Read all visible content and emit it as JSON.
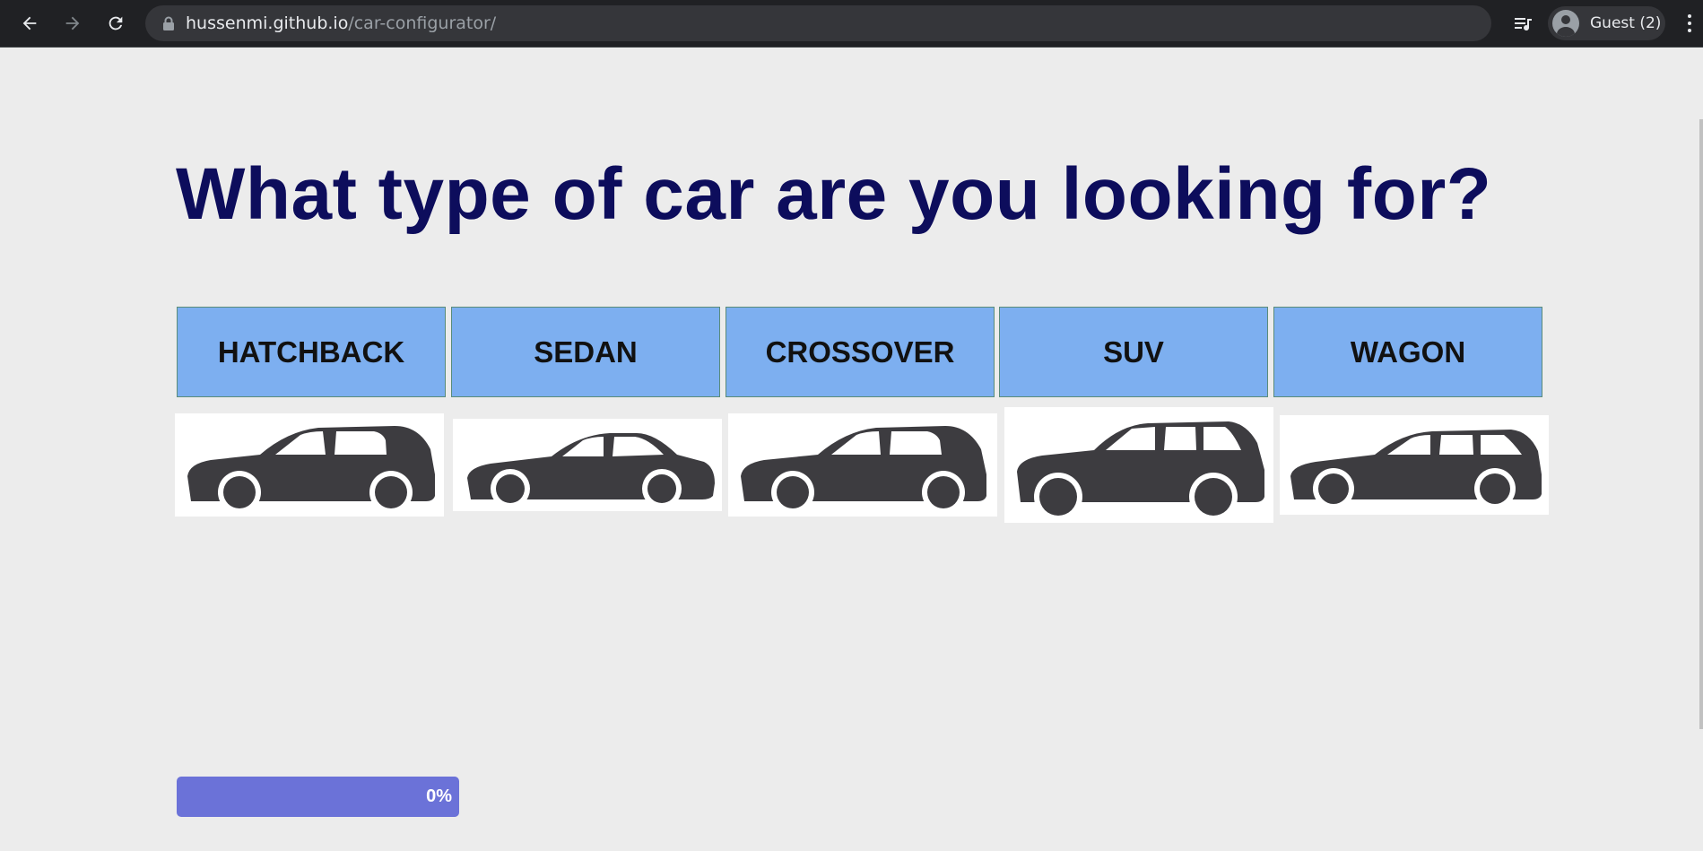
{
  "browser": {
    "url_host": "hussenmi.github.io",
    "url_path": "/car-configurator/",
    "profile_label": "Guest (2)",
    "icons": [
      "back-icon",
      "forward-icon",
      "reload-icon",
      "lock-icon",
      "tab-search-icon",
      "profile-avatar-icon",
      "kebab-menu-icon"
    ]
  },
  "page": {
    "question": "What type of car are you looking for?",
    "options": [
      {
        "label": "HATCHBACK",
        "image": "hatchback-car-icon"
      },
      {
        "label": "SEDAN",
        "image": "sedan-car-icon"
      },
      {
        "label": "CROSSOVER",
        "image": "crossover-car-icon"
      },
      {
        "label": "SUV",
        "image": "suv-car-icon"
      },
      {
        "label": "WAGON",
        "image": "wagon-car-icon"
      }
    ],
    "progress": {
      "label": "0%",
      "value": 0
    }
  },
  "colors": {
    "question_text": "#0d0d5c",
    "option_background": "#7daff0",
    "car_silhouette": "#3d3c40",
    "progress_bar": "#6b72d8"
  }
}
